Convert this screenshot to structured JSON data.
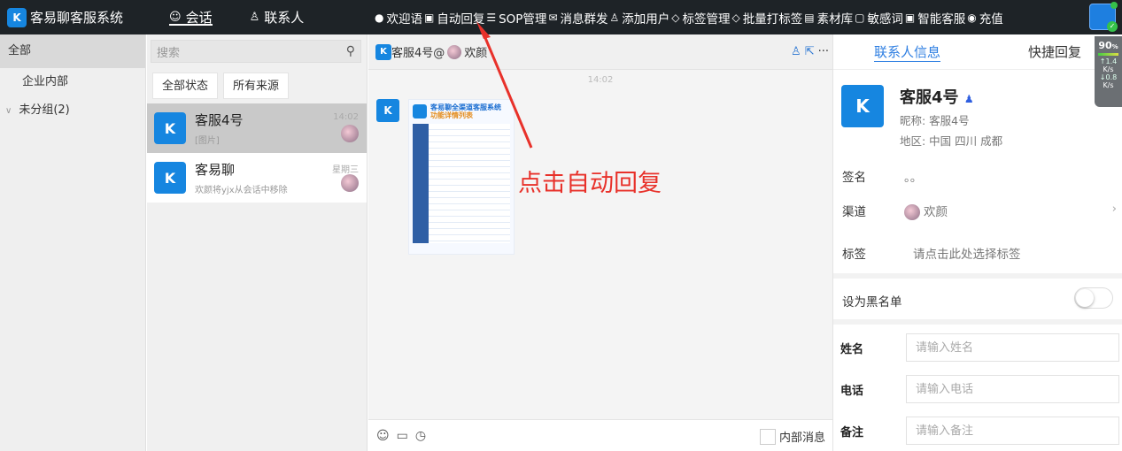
{
  "app": {
    "title": "客易聊客服系统",
    "logo_letter": "K"
  },
  "nav": {
    "conversations": "会话",
    "contacts": "联系人"
  },
  "toolbar": [
    {
      "label": "欢迎语",
      "icon": "welcome-icon"
    },
    {
      "label": "自动回复",
      "icon": "robot-icon"
    },
    {
      "label": "SOP管理",
      "icon": "list-icon"
    },
    {
      "label": "消息群发",
      "icon": "mail-icon"
    },
    {
      "label": "添加用户",
      "icon": "add-user-icon"
    },
    {
      "label": "标签管理",
      "icon": "tag-icon"
    },
    {
      "label": "批量打标签",
      "icon": "tag-icon"
    },
    {
      "label": "素材库",
      "icon": "library-icon"
    },
    {
      "label": "敏感词",
      "icon": "sensitive-word-icon"
    },
    {
      "label": "智能客服",
      "icon": "robot-icon"
    },
    {
      "label": "充值",
      "icon": "recharge-icon"
    }
  ],
  "groups": {
    "all": "全部",
    "internal": "企业内部",
    "ungrouped": "未分组(2)"
  },
  "conv_list": {
    "search_placeholder": "搜索",
    "filters": [
      "全部状态",
      "所有来源"
    ],
    "items": [
      {
        "name": "客服4号",
        "preview": "[图片]",
        "time": "14:02"
      },
      {
        "name": "客易聊",
        "preview": "欢颜将yjx从会话中移除",
        "time": "星期三"
      }
    ]
  },
  "chat": {
    "header": "客服4号@",
    "header_suffix": "欢颜",
    "time": "14:02",
    "poster": {
      "title": "客易聊全渠道客服系统",
      "subtitle": "功能详情列表"
    },
    "annotation": "点击自动回复",
    "internal_msg": "内部消息"
  },
  "right": {
    "tabs": {
      "info": "联系人信息",
      "quick": "快捷回复"
    },
    "profile": {
      "name": "客服4号",
      "nickname": "昵称: 客服4号",
      "region": "地区: 中国 四川 成都"
    },
    "signature_label": "签名",
    "signature": "。。",
    "channel_label": "渠道",
    "channel": "欢颜",
    "tag_label": "标签",
    "tag_placeholder": "请点击此处选择标签",
    "blacklist": "设为黑名单",
    "blacklist_on": false,
    "fields": [
      {
        "label": "姓名",
        "placeholder": "请输入姓名"
      },
      {
        "label": "电话",
        "placeholder": "请输入电话"
      },
      {
        "label": "备注",
        "placeholder": "请输入备注"
      }
    ]
  },
  "speed": {
    "pct": "90",
    "pct_unit": "%",
    "up": "1.4",
    "down": "0.8",
    "unit": "K/s"
  },
  "colors": {
    "accent": "#2f7fe2",
    "topbar": "#1e2327",
    "brand_blue": "#1686e0",
    "annotation": "#e8312a"
  }
}
